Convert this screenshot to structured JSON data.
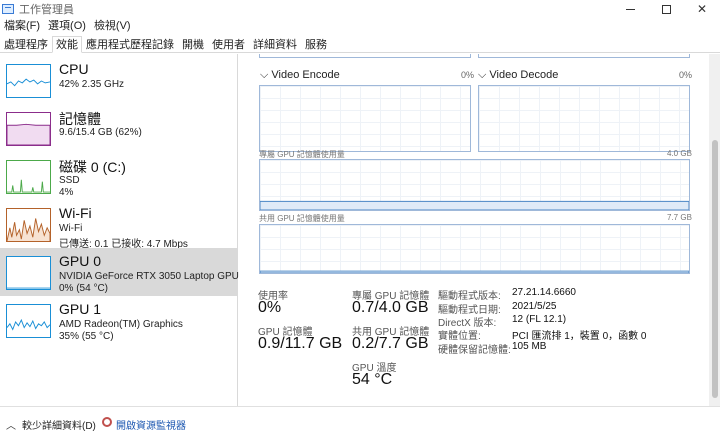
{
  "window": {
    "title": "工作管理員"
  },
  "menu": [
    "檔案(F)",
    "選項(O)",
    "檢視(V)"
  ],
  "tabs": [
    "處理程序",
    "效能",
    "應用程式歷程記錄",
    "開機",
    "使用者",
    "詳細資料",
    "服務"
  ],
  "active_tab": "效能",
  "resources": [
    {
      "name": "CPU",
      "line1": "42%  2.35 GHz",
      "line2": "",
      "color": "#1a8fd6"
    },
    {
      "name": "記憶體",
      "line1": "9.6/15.4 GB (62%)",
      "line2": "",
      "color": "#8b2d8b"
    },
    {
      "name": "磁碟 0 (C:)",
      "line1": "SSD",
      "line2": "4%",
      "color": "#4ca94a"
    },
    {
      "name": "Wi-Fi",
      "line1": "Wi-Fi",
      "line2": "已傳送: 0.1  已接收: 4.7 Mbps",
      "color": "#b4622a"
    },
    {
      "name": "GPU 0",
      "line1": "NVIDIA GeForce RTX 3050 Laptop GPU",
      "line2": "0% (54 °C)",
      "color": "#1a8fd6"
    },
    {
      "name": "GPU 1",
      "line1": "AMD Radeon(TM) Graphics",
      "line2": "35% (55 °C)",
      "color": "#1a8fd6"
    }
  ],
  "selected_resource": "GPU 0",
  "gpu_panel": {
    "encode_label": "Video Encode",
    "encode_pct": "0%",
    "decode_label": "Video Decode",
    "decode_pct": "0%",
    "dedicated_label": "專屬 GPU 記憶體使用量",
    "dedicated_max": "4.0 GB",
    "shared_label": "共用 GPU 記憶體使用量",
    "shared_max": "7.7 GB",
    "stats": {
      "util_label": "使用率",
      "util_value": "0%",
      "ded_label": "專屬 GPU 記憶體",
      "ded_value": "0.7/4.0 GB",
      "mem_label": "GPU 記憶體",
      "mem_value": "0.9/11.7 GB",
      "shared_label": "共用 GPU 記憶體",
      "shared_value": "0.2/7.7 GB",
      "temp_label": "GPU 溫度",
      "temp_value": "54 °C"
    },
    "details": [
      {
        "key": "驅動程式版本:",
        "value": "27.21.14.6660"
      },
      {
        "key": "驅動程式日期:",
        "value": "2021/5/25"
      },
      {
        "key": "DirectX 版本:",
        "value": "12 (FL 12.1)"
      },
      {
        "key": "實體位置:",
        "value": "PCI 匯流排 1，裝置 0，函數 0"
      },
      {
        "key": "硬體保留記憶體:",
        "value": "105 MB"
      }
    ]
  },
  "footer": {
    "fewer_details": "較少詳細資料(D)",
    "resource_monitor": "開啟資源監視器"
  }
}
